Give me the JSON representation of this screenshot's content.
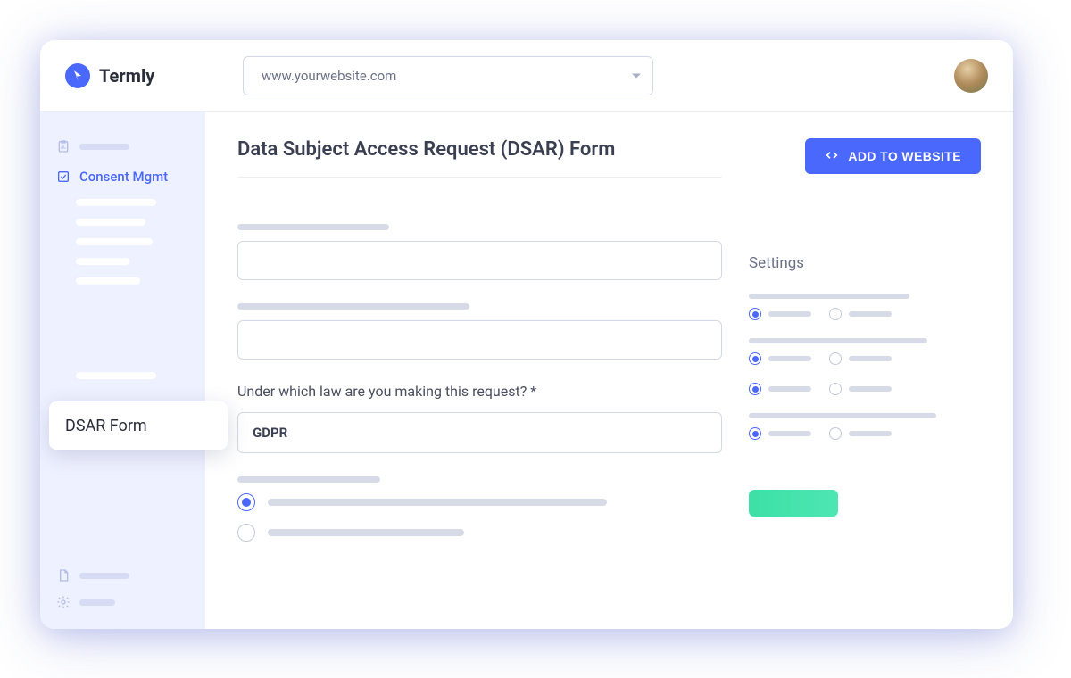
{
  "brand": {
    "name": "Termly"
  },
  "header": {
    "site_selector_value": "www.yourwebsite.com"
  },
  "sidebar": {
    "consent_mgmt_label": "Consent Mgmt",
    "floating_card_label": "DSAR Form"
  },
  "main": {
    "title": "Data Subject Access Request (DSAR) Form",
    "add_button_label": "ADD TO WEBSITE",
    "law_question_label": "Under which law are you making this request? *",
    "law_selected": "GDPR"
  },
  "settings": {
    "title": "Settings"
  },
  "colors": {
    "primary": "#4b68fc",
    "green": "#3de0a7"
  }
}
